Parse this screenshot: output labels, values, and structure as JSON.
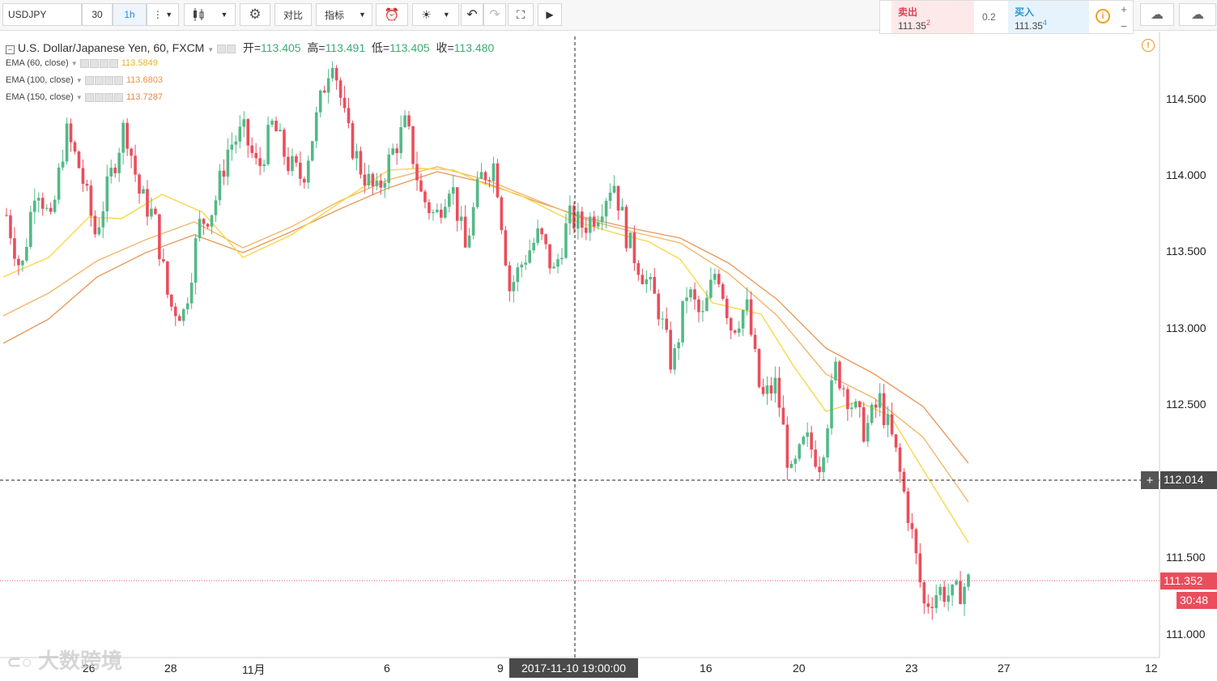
{
  "toolbar": {
    "symbol": "USDJPY",
    "interval_value": "30",
    "interval_active": "1h",
    "compare_label": "对比",
    "indicators_label": "指标"
  },
  "trade_panel": {
    "sell_label": "卖出",
    "sell_price_main": "111.35",
    "sell_price_sup": "2",
    "spread": "0.2",
    "buy_label": "买入",
    "buy_price_main": "111.35",
    "buy_price_sup": "4",
    "plus": "+",
    "minus": "−"
  },
  "legend": {
    "title": "U.S. Dollar/Japanese Yen, 60, FXCM",
    "open_label": "开=",
    "open_value": "113.405",
    "high_label": "高=",
    "high_value": "113.491",
    "low_label": "低=",
    "low_value": "113.405",
    "close_label": "收=",
    "close_value": "113.480",
    "ema": [
      {
        "name": "EMA (60, close)",
        "value": "113.5849",
        "color": "#f2c94c"
      },
      {
        "name": "EMA (100, close)",
        "value": "113.6803",
        "color": "#f0a35a"
      },
      {
        "name": "EMA (150, close)",
        "value": "113.7287",
        "color": "#e8935a"
      }
    ]
  },
  "colors": {
    "up": "#53b987",
    "down": "#eb4d5c",
    "ema60": "#f7d84a",
    "ema100": "#f3b66a",
    "ema150": "#eb9a5e",
    "crosshair_label_bg": "#4a4a4a",
    "last_price_bg": "#eb4d5c"
  },
  "price_axis": {
    "labels": [
      "114.500",
      "114.000",
      "113.500",
      "113.000",
      "112.500",
      "112.000",
      "111.500",
      "111.000"
    ],
    "crosshair_price": "112.014",
    "last_price": "111.352",
    "countdown": "30:48"
  },
  "time_axis": {
    "labels": [
      "26",
      "28",
      "11月",
      "6",
      "9",
      "16",
      "20",
      "23",
      "27",
      "12"
    ],
    "crosshair_time": "2017-11-10 19:00:00"
  },
  "watermark": "大数跨境",
  "chart_data": {
    "type": "candlestick",
    "title": "U.S. Dollar/Japanese Yen, 60, FXCM",
    "ylim": [
      110.87,
      114.8
    ],
    "x_ticks": [
      "26",
      "28",
      "11月",
      "6",
      "9",
      "16",
      "20",
      "23",
      "27",
      "12"
    ],
    "series": [
      {
        "name": "USDJPY close (approx.)",
        "values": [
          113.67,
          113.3,
          113.9,
          113.6,
          114.2,
          113.95,
          113.55,
          113.9,
          114.25,
          113.8,
          113.65,
          113.1,
          113.05,
          113.6,
          113.72,
          114.1,
          114.2,
          113.95,
          114.25,
          114.0,
          113.9,
          114.3,
          114.7,
          114.2,
          113.95,
          113.8,
          114.05,
          114.25,
          113.8,
          113.65,
          113.9,
          113.45,
          113.9,
          114.0,
          113.2,
          113.4,
          113.55,
          113.3,
          113.65,
          113.6,
          113.7,
          113.9,
          113.5,
          113.3,
          113.1,
          112.7,
          113.2,
          113.0,
          113.35,
          112.95,
          113.1,
          112.5,
          112.6,
          112.0,
          112.25,
          112.1,
          112.7,
          112.5,
          112.3,
          112.5,
          112.2,
          111.75,
          111.2,
          111.3,
          111.25,
          111.35
        ]
      },
      {
        "name": "EMA (60, close)",
        "values": [
          113.33,
          113.55,
          113.7,
          113.78,
          113.8,
          113.65,
          113.55,
          113.75,
          113.9,
          114.03,
          113.95,
          113.85,
          113.7,
          113.5,
          113.1,
          112.9,
          112.85,
          112.45,
          111.6
        ]
      },
      {
        "name": "EMA (100, close)",
        "values": [
          113.1,
          113.3,
          113.45,
          113.58,
          113.65,
          113.62,
          113.58,
          113.7,
          113.82,
          113.95,
          113.92,
          113.85,
          113.65,
          113.5,
          113.2,
          112.8,
          112.6,
          112.28,
          111.85
        ]
      },
      {
        "name": "EMA (150, close)",
        "values": [
          112.9,
          113.1,
          113.3,
          113.45,
          113.5,
          113.5,
          113.52,
          113.62,
          113.75,
          113.87,
          113.88,
          113.8,
          113.6,
          113.3,
          112.9,
          112.75,
          112.55,
          112.1
        ]
      }
    ],
    "crosshair": {
      "time": "2017-11-10 19:00:00",
      "price": "112.014"
    },
    "last_price": "111.352"
  }
}
